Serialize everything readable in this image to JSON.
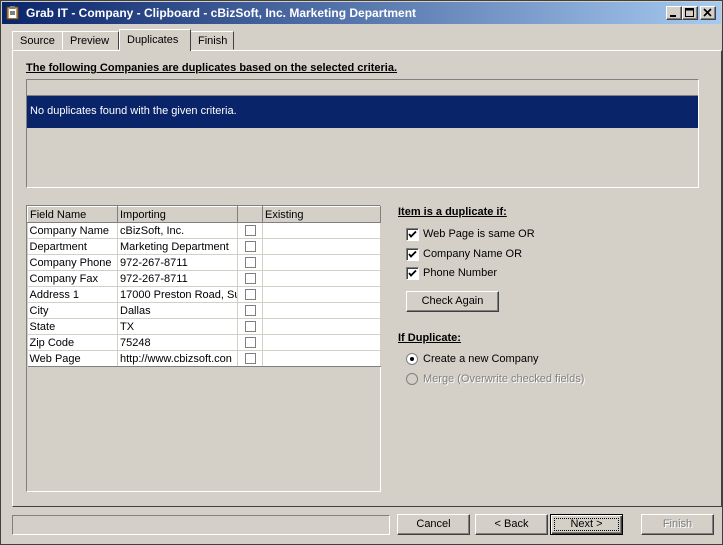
{
  "window": {
    "title": "Grab IT - Company - Clipboard - cBizSoft, Inc. Marketing Department",
    "icons": [
      "app-clipboard-icon",
      "minimize-icon",
      "maximize-icon",
      "close-icon"
    ]
  },
  "tabs": [
    {
      "label": "Source"
    },
    {
      "label": "Preview"
    },
    {
      "label": "Duplicates",
      "active": true
    },
    {
      "label": "Finish"
    }
  ],
  "duplicates": {
    "heading": "The following Companies are duplicates based on the selected criteria.",
    "message": "No duplicates found with the given criteria."
  },
  "grid": {
    "columns": [
      "Field Name",
      "Importing",
      "",
      "Existing"
    ],
    "rows": [
      {
        "field": "Company Name",
        "importing": "cBizSoft, Inc.",
        "checked": false,
        "existing": ""
      },
      {
        "field": "Department",
        "importing": "Marketing Department",
        "checked": false,
        "existing": ""
      },
      {
        "field": "Company Phone",
        "importing": "972-267-8711",
        "checked": false,
        "existing": ""
      },
      {
        "field": "Company Fax",
        "importing": "972-267-8711",
        "checked": false,
        "existing": ""
      },
      {
        "field": "Address 1",
        "importing": "17000 Preston Road, Su",
        "checked": false,
        "existing": ""
      },
      {
        "field": "City",
        "importing": "Dallas",
        "checked": false,
        "existing": ""
      },
      {
        "field": "State",
        "importing": "TX",
        "checked": false,
        "existing": ""
      },
      {
        "field": "Zip Code",
        "importing": "75248",
        "checked": false,
        "existing": ""
      },
      {
        "field": "Web Page",
        "importing": "http://www.cbizsoft.con",
        "checked": false,
        "existing": ""
      }
    ]
  },
  "criteria": {
    "heading": "Item is a duplicate if:",
    "options": [
      {
        "label": "Web Page is same OR",
        "checked": true
      },
      {
        "label": "Company Name OR",
        "checked": true
      },
      {
        "label": "Phone Number",
        "checked": true
      }
    ],
    "check_again": "Check Again"
  },
  "if_duplicate": {
    "heading": "If Duplicate:",
    "options": [
      {
        "label": "Create a new Company",
        "selected": true,
        "enabled": true
      },
      {
        "label": "Merge (Overwrite checked fields)",
        "selected": false,
        "enabled": false
      }
    ]
  },
  "footer": {
    "status_text": "",
    "cancel": "Cancel",
    "back": "< Back",
    "next": "Next >",
    "finish": "Finish"
  }
}
